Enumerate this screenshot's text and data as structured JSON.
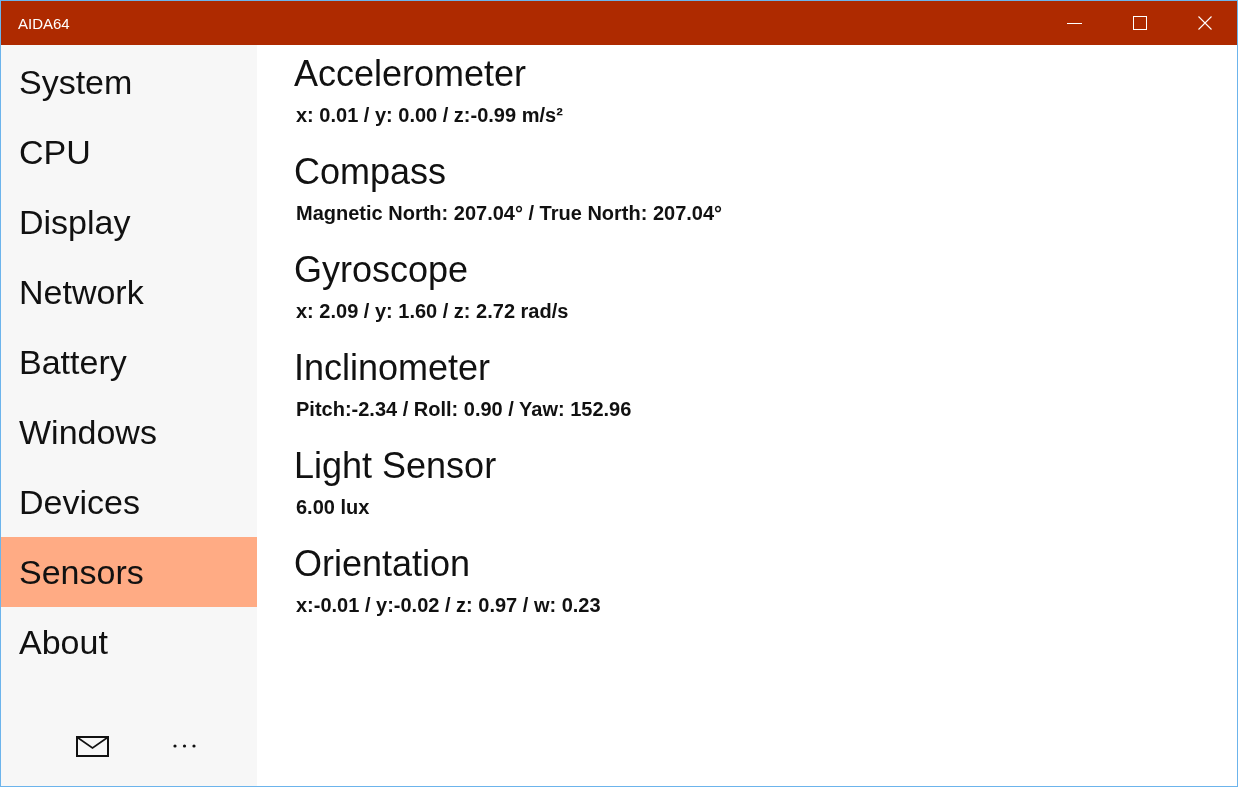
{
  "window": {
    "title": "AIDA64"
  },
  "sidebar": {
    "items": [
      {
        "label": "System",
        "selected": false
      },
      {
        "label": "CPU",
        "selected": false
      },
      {
        "label": "Display",
        "selected": false
      },
      {
        "label": "Network",
        "selected": false
      },
      {
        "label": "Battery",
        "selected": false
      },
      {
        "label": "Windows",
        "selected": false
      },
      {
        "label": "Devices",
        "selected": false
      },
      {
        "label": "Sensors",
        "selected": true
      },
      {
        "label": "About",
        "selected": false
      }
    ]
  },
  "sensors": [
    {
      "title": "Accelerometer",
      "value": "x: 0.01 / y: 0.00 / z:-0.99 m/s²"
    },
    {
      "title": "Compass",
      "value": "Magnetic North: 207.04° / True North: 207.04°"
    },
    {
      "title": "Gyroscope",
      "value": "x: 2.09 / y: 1.60 / z: 2.72 rad/s"
    },
    {
      "title": "Inclinometer",
      "value": "Pitch:-2.34 / Roll: 0.90 / Yaw: 152.96"
    },
    {
      "title": "Light Sensor",
      "value": "6.00 lux"
    },
    {
      "title": "Orientation",
      "value": "x:-0.01 / y:-0.02 / z: 0.97 / w: 0.23"
    }
  ]
}
